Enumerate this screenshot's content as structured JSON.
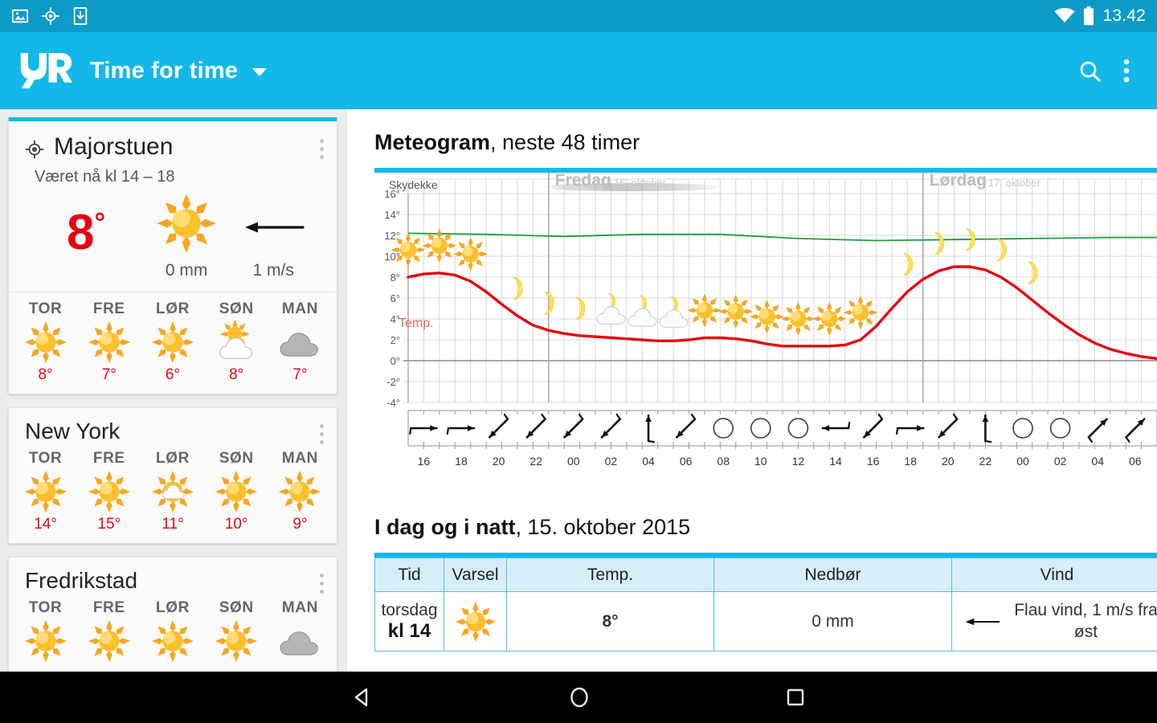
{
  "status_bar": {
    "time": "13.42",
    "icons": [
      "image-icon",
      "location-icon",
      "download-icon",
      "wifi-icon",
      "battery-icon"
    ]
  },
  "app_bar": {
    "logo": "yr-logo",
    "title": "Time for time",
    "dropdown_icon": "chevron-down-icon",
    "search_icon": "search-icon",
    "overflow_icon": "overflow-menu-icon"
  },
  "sidebar": {
    "cards": [
      {
        "name": "Majorstuen",
        "has_location_pin": true,
        "accent": true,
        "subline": "Været nå kl 14 – 18",
        "now": {
          "temp": "8",
          "degree": "°",
          "symbol": "sun",
          "precip": "0 mm",
          "wind": "1 m/s",
          "wind_arrow": "arrow-west"
        },
        "days": [
          {
            "label": "TOR",
            "symbol": "sun",
            "temp": "8°"
          },
          {
            "label": "FRE",
            "symbol": "sun",
            "temp": "7°"
          },
          {
            "label": "LØR",
            "symbol": "sun",
            "temp": "6°"
          },
          {
            "label": "SØN",
            "symbol": "partly-cloudy",
            "temp": "8°"
          },
          {
            "label": "MAN",
            "symbol": "cloudy",
            "temp": "7°"
          }
        ]
      },
      {
        "name": "New York",
        "has_location_pin": false,
        "accent": false,
        "days": [
          {
            "label": "TOR",
            "symbol": "sun",
            "temp": "14°"
          },
          {
            "label": "FRE",
            "symbol": "sun",
            "temp": "15°"
          },
          {
            "label": "LØR",
            "symbol": "sun-small-cloud",
            "temp": "11°"
          },
          {
            "label": "SØN",
            "symbol": "sun",
            "temp": "10°"
          },
          {
            "label": "MAN",
            "symbol": "sun",
            "temp": "9°"
          }
        ]
      },
      {
        "name": "Fredrikstad",
        "has_location_pin": false,
        "accent": false,
        "days": [
          {
            "label": "TOR",
            "symbol": "sun",
            "temp": ""
          },
          {
            "label": "FRE",
            "symbol": "sun",
            "temp": ""
          },
          {
            "label": "LØR",
            "symbol": "sun",
            "temp": ""
          },
          {
            "label": "SØN",
            "symbol": "sun",
            "temp": ""
          },
          {
            "label": "MAN",
            "symbol": "cloudy",
            "temp": ""
          }
        ]
      }
    ]
  },
  "main": {
    "meteogram_title_bold": "Meteogram",
    "meteogram_title_rest": ", neste 48 timer",
    "today_title_bold": "I dag og i natt",
    "today_title_rest": ", 15. oktober 2015",
    "table": {
      "headers": [
        "Tid",
        "Varsel",
        "Temp.",
        "Nedbør",
        "Vind"
      ],
      "rows": [
        {
          "day": "torsdag",
          "hour": "kl 14",
          "symbol": "sun",
          "temp": "8°",
          "precip": "0 mm",
          "wind_arrow": "arrow-west",
          "wind": "Flau vind, 1 m/s fra øst"
        }
      ]
    }
  },
  "chart_data": {
    "type": "line",
    "title": "Meteogram, neste 48 timer",
    "cloud_label": "Skydekke",
    "temp_label": "Temp.",
    "day_markers": [
      {
        "name": "Fredag",
        "date": "16. oktober",
        "x_hour": "00"
      },
      {
        "name": "Lørdag",
        "date": "17. oktober",
        "x_hour": "00"
      }
    ],
    "xlabel": "",
    "ylabel": "",
    "x_ticks": [
      "16",
      "18",
      "20",
      "22",
      "00",
      "02",
      "04",
      "06",
      "08",
      "10",
      "12",
      "14",
      "16",
      "18",
      "20",
      "22",
      "00",
      "02",
      "04",
      "06"
    ],
    "y_ticks": [
      "16°",
      "14°",
      "12°",
      "10°",
      "8°",
      "6°",
      "4°",
      "2°",
      "0°",
      "-2°",
      "-4°"
    ],
    "ylim": [
      -4,
      16
    ],
    "grid": true,
    "series": [
      {
        "name": "Temp.",
        "color": "#e30613",
        "negative_color": "#1464d2",
        "hours": [
          15,
          16,
          17,
          18,
          19,
          20,
          21,
          22,
          23,
          24,
          25,
          26,
          27,
          28,
          29,
          30,
          31,
          32,
          33,
          34,
          35,
          36,
          37,
          38,
          39,
          40,
          41,
          42,
          43,
          44,
          45,
          46,
          47,
          48,
          49,
          50,
          51,
          52,
          53,
          54,
          55,
          56,
          57,
          58,
          59,
          60,
          61,
          62,
          63
        ],
        "values": [
          8.0,
          8.3,
          8.4,
          8.2,
          7.6,
          6.6,
          5.4,
          4.3,
          3.4,
          2.9,
          2.6,
          2.4,
          2.3,
          2.2,
          2.1,
          2.0,
          1.9,
          1.9,
          2.0,
          2.2,
          2.2,
          2.1,
          1.9,
          1.6,
          1.4,
          1.4,
          1.4,
          1.4,
          1.5,
          2.0,
          3.3,
          5.0,
          6.6,
          7.8,
          8.6,
          9.0,
          9.0,
          8.7,
          8.0,
          7.0,
          5.8,
          4.6,
          3.5,
          2.5,
          1.7,
          1.1,
          0.7,
          0.4,
          0.2
        ]
      },
      {
        "name": "Skydekke-linje",
        "color": "#1e9e3e",
        "hours": [
          15,
          20,
          25,
          30,
          35,
          40,
          45,
          50,
          55,
          60,
          63
        ],
        "values": [
          12.2,
          12.1,
          11.9,
          12.1,
          12.1,
          11.7,
          11.5,
          11.6,
          11.7,
          11.8,
          11.8
        ]
      }
    ],
    "weather_symbols": [
      {
        "hour": 15,
        "symbol": "sun"
      },
      {
        "hour": 17,
        "symbol": "sun"
      },
      {
        "hour": 19,
        "symbol": "sun"
      },
      {
        "hour": 22,
        "symbol": "moon"
      },
      {
        "hour": 24,
        "symbol": "moon"
      },
      {
        "hour": 26,
        "symbol": "moon"
      },
      {
        "hour": 28,
        "symbol": "partly-cloudy-night"
      },
      {
        "hour": 30,
        "symbol": "partly-cloudy-night"
      },
      {
        "hour": 32,
        "symbol": "partly-cloudy-night"
      },
      {
        "hour": 34,
        "symbol": "sun"
      },
      {
        "hour": 36,
        "symbol": "sun"
      },
      {
        "hour": 38,
        "symbol": "sun"
      },
      {
        "hour": 40,
        "symbol": "sun"
      },
      {
        "hour": 42,
        "symbol": "sun"
      },
      {
        "hour": 44,
        "symbol": "sun"
      },
      {
        "hour": 47,
        "symbol": "moon"
      },
      {
        "hour": 49,
        "symbol": "moon"
      },
      {
        "hour": 51,
        "symbol": "moon"
      },
      {
        "hour": 53,
        "symbol": "moon"
      },
      {
        "hour": 55,
        "symbol": "moon"
      }
    ],
    "wind_arrows": [
      "W",
      "W",
      "NE",
      "NE",
      "NE",
      "NE",
      "S",
      "NE",
      "calm",
      "calm",
      "calm",
      "E",
      "NE",
      "W",
      "NE",
      "S",
      "calm",
      "calm",
      "SW",
      "SW",
      "SW"
    ]
  },
  "nav_bar": {
    "back_icon": "back-triangle-icon",
    "home_icon": "home-circle-icon",
    "recents_icon": "recents-square-icon"
  }
}
